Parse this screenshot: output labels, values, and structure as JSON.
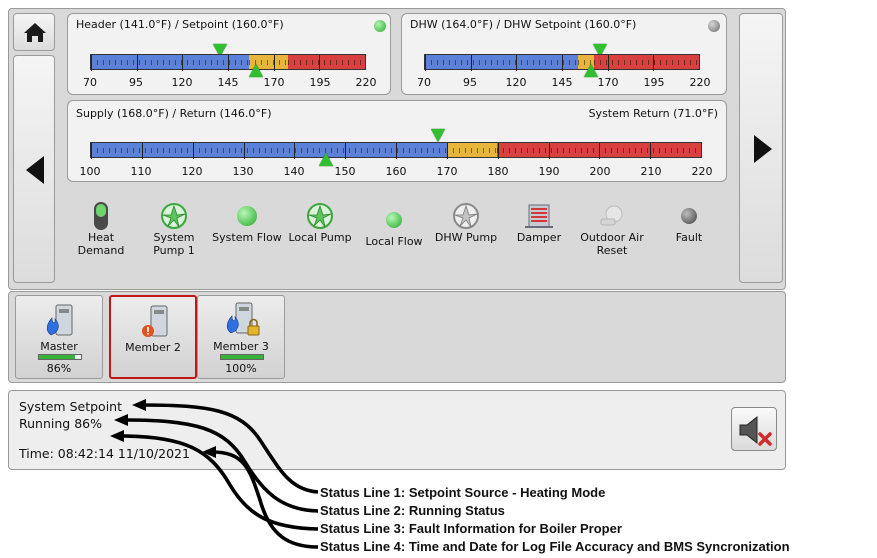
{
  "gauges": {
    "header": {
      "title": "Header (141.0°F) / Setpoint (160.0°F)",
      "led_color": "#3fbf3f",
      "ticks": [
        "70",
        "95",
        "120",
        "145",
        "170",
        "195",
        "220"
      ]
    },
    "dhw": {
      "title": "DHW (164.0°F) / DHW Setpoint (160.0°F)",
      "led_color": "#8a8a8a",
      "ticks": [
        "70",
        "95",
        "120",
        "145",
        "170",
        "195",
        "220"
      ]
    },
    "supply": {
      "title": "Supply (168.0°F) / Return (146.0°F)",
      "right_title": "System Return (71.0°F)",
      "ticks": [
        "100",
        "110",
        "120",
        "130",
        "140",
        "150",
        "160",
        "170",
        "180",
        "190",
        "200",
        "210",
        "220"
      ]
    }
  },
  "status_icons": [
    {
      "label": "Heat Demand",
      "icon": "heat-demand-switch-icon"
    },
    {
      "label": "System Pump 1",
      "icon": "pump-icon"
    },
    {
      "label": "System Flow",
      "icon": "flow-led-icon"
    },
    {
      "label": "Local Pump",
      "icon": "pump-icon"
    },
    {
      "label": "Local Flow",
      "icon": "flow-led-icon"
    },
    {
      "label": "DHW Pump",
      "icon": "pump-gray-icon"
    },
    {
      "label": "Damper",
      "icon": "damper-icon"
    },
    {
      "label": "Outdoor Air Reset",
      "icon": "outdoor-sensor-icon"
    },
    {
      "label": "Fault",
      "icon": "fault-led-icon"
    }
  ],
  "boilers": [
    {
      "name": "Master",
      "percent": "86%",
      "level": 0.86
    },
    {
      "name": "Member 2",
      "percent": "",
      "level": 0
    },
    {
      "name": "Member 3",
      "percent": "100%",
      "level": 1.0
    }
  ],
  "status": {
    "line1": "System Setpoint",
    "line2": "Running 86%",
    "line4": "Time: 08:42:14 11/10/2021"
  },
  "annotations": [
    "Status Line 1: Setpoint Source - Heating Mode",
    "Status Line 2: Running Status",
    "Status Line 3: Fault Information for Boiler Proper",
    "Status Line 4: Time and Date for Log File Accuracy and BMS Syncronization"
  ],
  "colors": {
    "cold": "#5b82d8",
    "band": "#e7b43c",
    "hot": "#d94040",
    "marker": "#2fbf2f",
    "selected_border": "#c01818"
  }
}
